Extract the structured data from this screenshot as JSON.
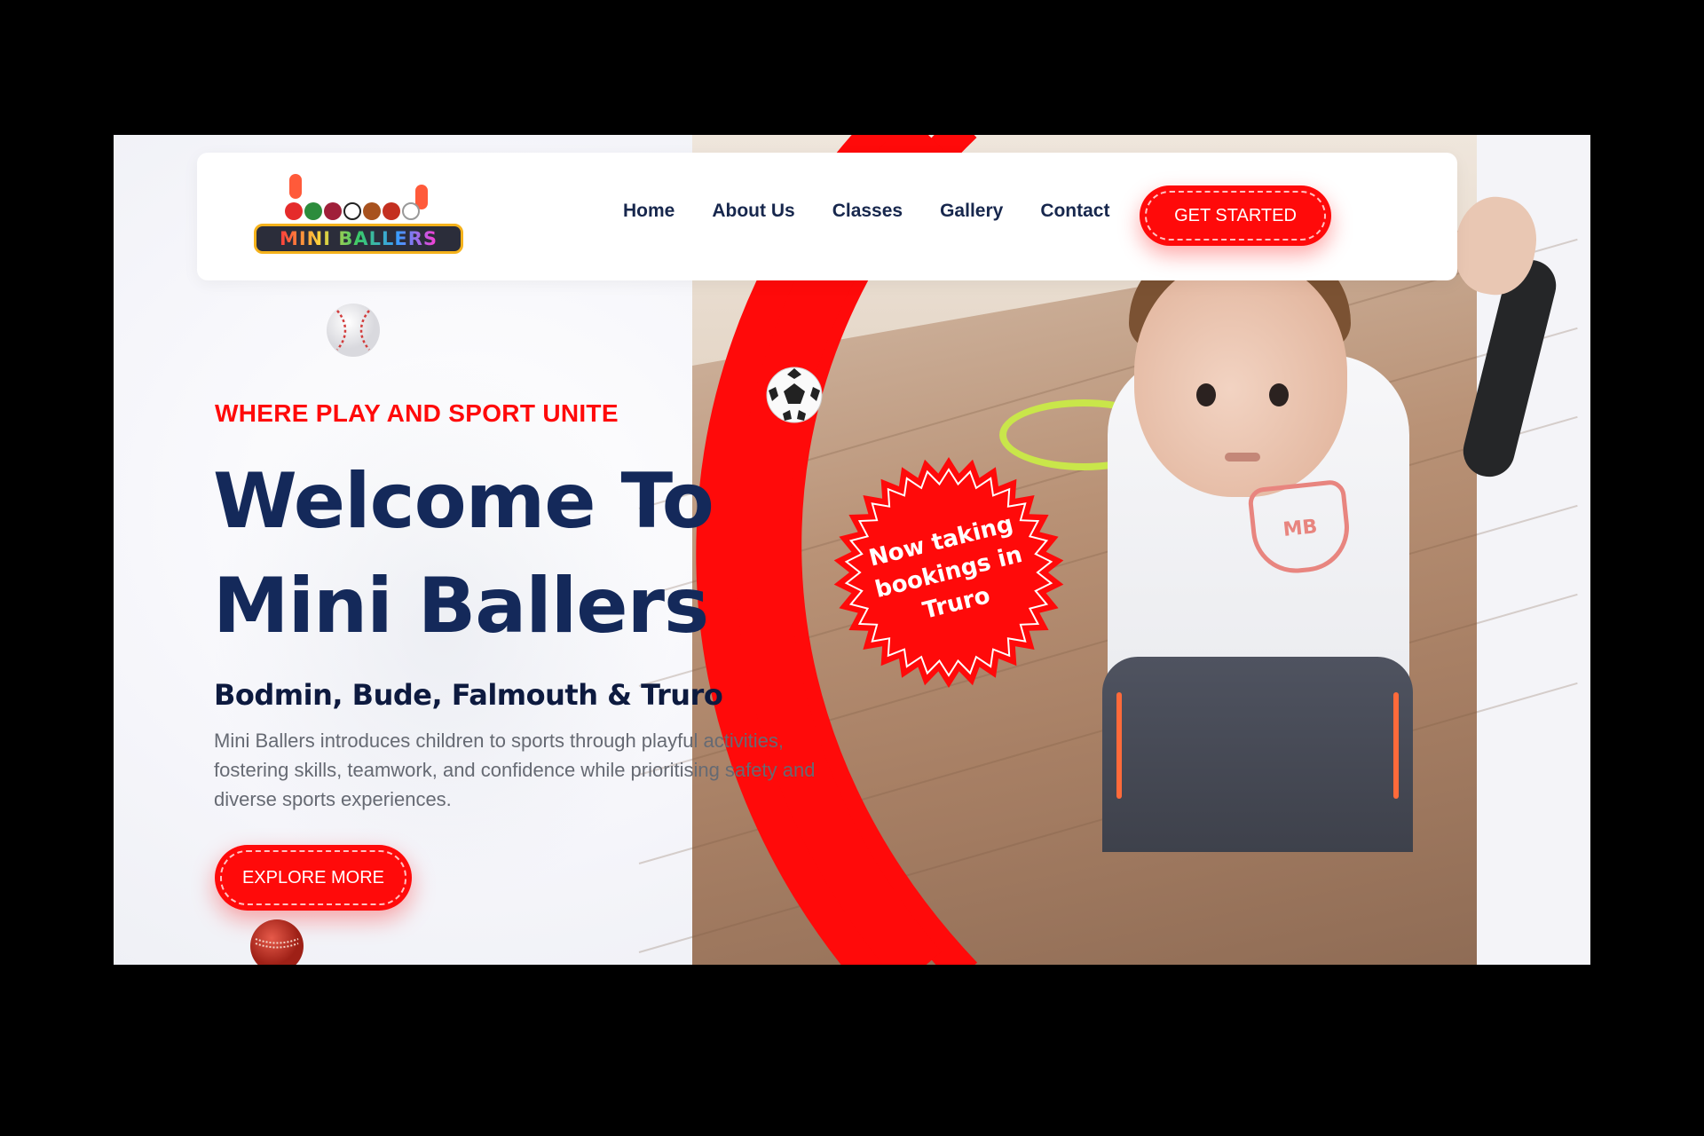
{
  "header": {
    "logo_text": "MINI BALLERS",
    "nav": [
      "Home",
      "About Us",
      "Classes",
      "Gallery",
      "Contact"
    ],
    "cta": "GET STARTED"
  },
  "hero": {
    "tagline": "WHERE PLAY AND SPORT UNITE",
    "title_line1": "Welcome To",
    "title_line2": "Mini Ballers",
    "locations": "Bodmin, Bude, Falmouth & Truro",
    "description": "Mini Ballers introduces children to sports through playful activities, fostering skills, teamwork, and confidence while prioritising safety and diverse sports experiences.",
    "cta": "EXPLORE MORE"
  },
  "badge": {
    "line1": "Now taking",
    "line2": "bookings in",
    "line3": "Truro"
  },
  "shirt_logo": "MB",
  "colors": {
    "accent": "#ff0a0a",
    "navy": "#14295a",
    "nav_text": "#17274d",
    "body_text": "#666a73"
  },
  "icons": [
    "baseball-icon",
    "football-icon",
    "cricket-ball-icon"
  ]
}
